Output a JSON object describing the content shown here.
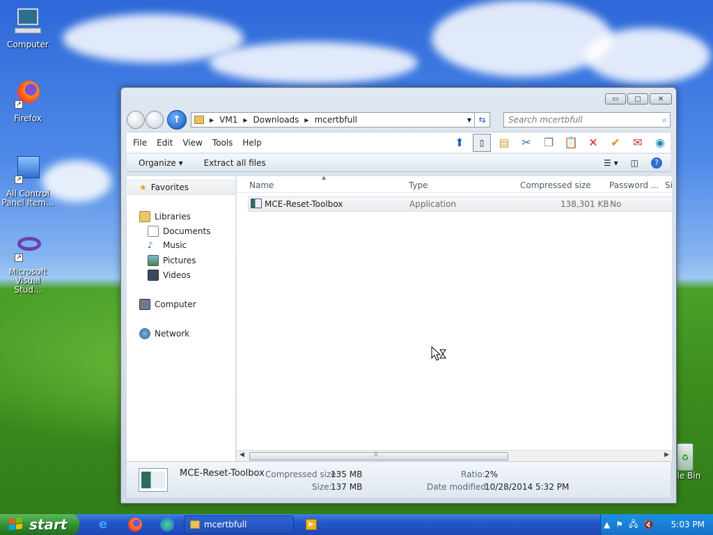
{
  "desktop": {
    "icons": [
      {
        "label": "Computer"
      },
      {
        "label": "Firefox"
      },
      {
        "label": "All Control Panel Item..."
      },
      {
        "label": "Microsoft Visual Stud..."
      }
    ],
    "recycle_bin_label": "cle Bin"
  },
  "window": {
    "caption_buttons": {
      "minimize": "▭",
      "maximize": "□",
      "close": "✕"
    },
    "address": {
      "crumbs": [
        "VM1",
        "Downloads",
        "mcertbfull"
      ]
    },
    "search": {
      "placeholder": "Search mcertbfull"
    },
    "menu": [
      "File",
      "Edit",
      "View",
      "Tools",
      "Help"
    ],
    "commands": {
      "organize": "Organize",
      "extract": "Extract all files"
    },
    "nav": {
      "favorites": "Favorites",
      "libraries": "Libraries",
      "documents": "Documents",
      "music": "Music",
      "pictures": "Pictures",
      "videos": "Videos",
      "computer": "Computer",
      "network": "Network"
    },
    "columns": [
      "Name",
      "Type",
      "Compressed size",
      "Password ...",
      "Si"
    ],
    "files": [
      {
        "name": "MCE-Reset-Toolbox",
        "type": "Application",
        "compressed_size": "138,301 KB",
        "password": "No"
      }
    ],
    "details": {
      "name": "MCE-Reset-Toolbox",
      "compressed_label": "Compressed size:",
      "compressed_value": "135 MB",
      "size_label": "Size:",
      "size_value": "137 MB",
      "ratio_label": "Ratio:",
      "ratio_value": "2%",
      "modified_label": "Date modified:",
      "modified_value": "10/28/2014 5:32 PM"
    }
  },
  "taskbar": {
    "start_label": "start",
    "task_label": "mcertbfull",
    "clock": "5:03 PM"
  }
}
